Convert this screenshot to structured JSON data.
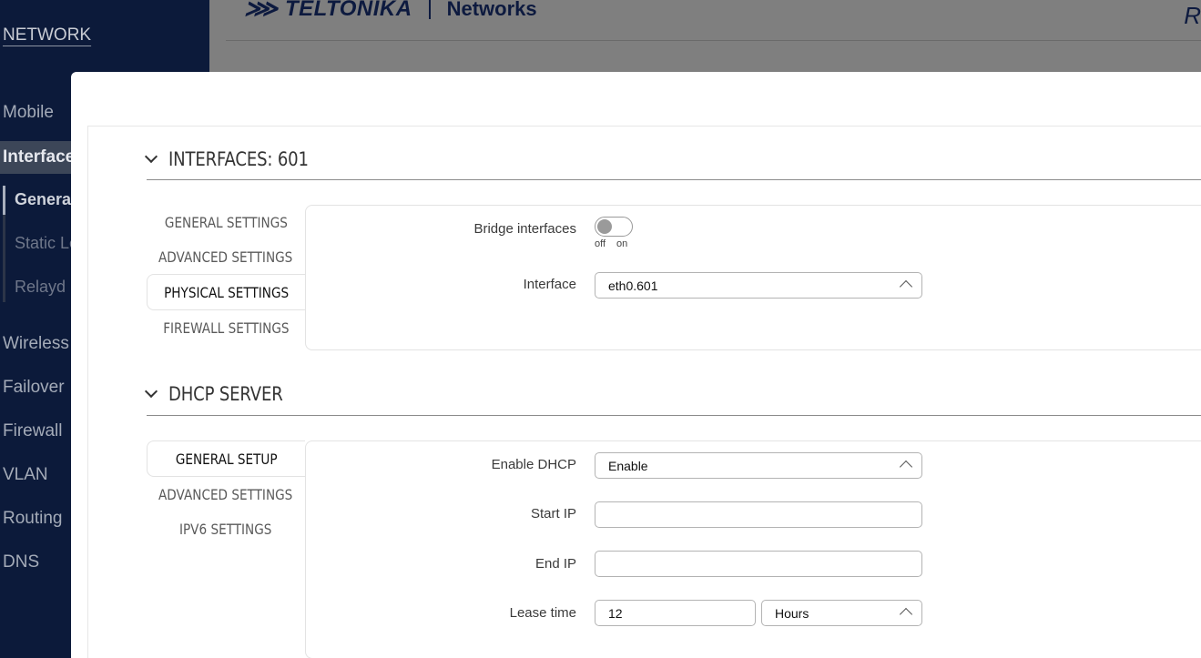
{
  "sidebar": {
    "section": "NETWORK",
    "items": [
      {
        "label": "Mobile"
      },
      {
        "label": "Interfaces"
      },
      {
        "label": "Wireless"
      },
      {
        "label": "Failover"
      },
      {
        "label": "Firewall"
      },
      {
        "label": "VLAN"
      },
      {
        "label": "Routing"
      },
      {
        "label": "DNS"
      }
    ],
    "subitems": [
      {
        "label": "General"
      },
      {
        "label": "Static Leases"
      },
      {
        "label": "Relayd"
      }
    ]
  },
  "header": {
    "brand": "TELTONIKA",
    "brand_suffix": "Networks",
    "right_fragment": "R"
  },
  "interfaces_section": {
    "title": "INTERFACES: 601",
    "tabs": [
      {
        "label": "GENERAL SETTINGS"
      },
      {
        "label": "ADVANCED SETTINGS"
      },
      {
        "label": "PHYSICAL SETTINGS"
      },
      {
        "label": "FIREWALL SETTINGS"
      }
    ],
    "bridge_label": "Bridge interfaces",
    "toggle_off": "off",
    "toggle_on": "on",
    "toggle_state": "off",
    "interface_label": "Interface",
    "interface_value": "eth0.601"
  },
  "dhcp_section": {
    "title": "DHCP SERVER",
    "tabs": [
      {
        "label": "GENERAL SETUP"
      },
      {
        "label": "ADVANCED SETTINGS"
      },
      {
        "label": "IPV6 SETTINGS"
      }
    ],
    "enable_label": "Enable DHCP",
    "enable_value": "Enable",
    "start_ip_label": "Start IP",
    "start_ip_value": "",
    "end_ip_label": "End IP",
    "end_ip_value": "",
    "lease_label": "Lease time",
    "lease_value": "12",
    "lease_unit": "Hours"
  }
}
